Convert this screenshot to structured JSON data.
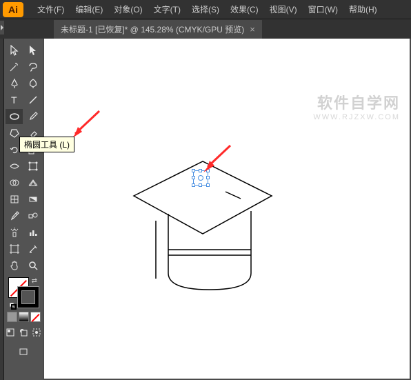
{
  "app": {
    "logo": "Ai"
  },
  "menu": {
    "file": "文件(F)",
    "edit": "编辑(E)",
    "object": "对象(O)",
    "type": "文字(T)",
    "select": "选择(S)",
    "effect": "效果(C)",
    "view": "视图(V)",
    "window": "窗口(W)",
    "help": "帮助(H)"
  },
  "tab": {
    "title": "未标题-1 [已恢复]* @ 145.28% (CMYK/GPU 预览)",
    "close": "×"
  },
  "tooltip": {
    "ellipse": "椭圆工具 (L)"
  },
  "watermark": {
    "line1": "软件自学网",
    "line2": "WWW.RJZXW.COM"
  },
  "tools": {
    "selection": "selection-tool",
    "direct_selection": "direct-selection-tool",
    "magic_wand": "magic-wand-tool",
    "lasso": "lasso-tool",
    "pen": "pen-tool",
    "curvature": "curvature-tool",
    "type": "type-tool",
    "line": "line-segment-tool",
    "ellipse": "ellipse-tool",
    "brush": "paintbrush-tool",
    "shaper": "shaper-tool",
    "eraser": "eraser-tool",
    "rotate": "rotate-tool",
    "scale": "scale-tool",
    "width": "width-tool",
    "free_transform": "free-transform-tool",
    "shape_builder": "shape-builder-tool",
    "perspective": "perspective-grid-tool",
    "mesh": "mesh-tool",
    "gradient": "gradient-tool",
    "eyedropper": "eyedropper-tool",
    "blend": "blend-tool",
    "symbol": "symbol-sprayer-tool",
    "graph": "column-graph-tool",
    "artboard": "artboard-tool",
    "slice": "slice-tool",
    "hand": "hand-tool",
    "zoom": "zoom-tool"
  },
  "colors": {
    "fill": "none",
    "stroke": "#000000",
    "row": [
      "#000000",
      "#ffffff",
      "none"
    ]
  },
  "canvas": {
    "zoom": "145.28%",
    "color_mode": "CMYK",
    "preview": "GPU"
  }
}
